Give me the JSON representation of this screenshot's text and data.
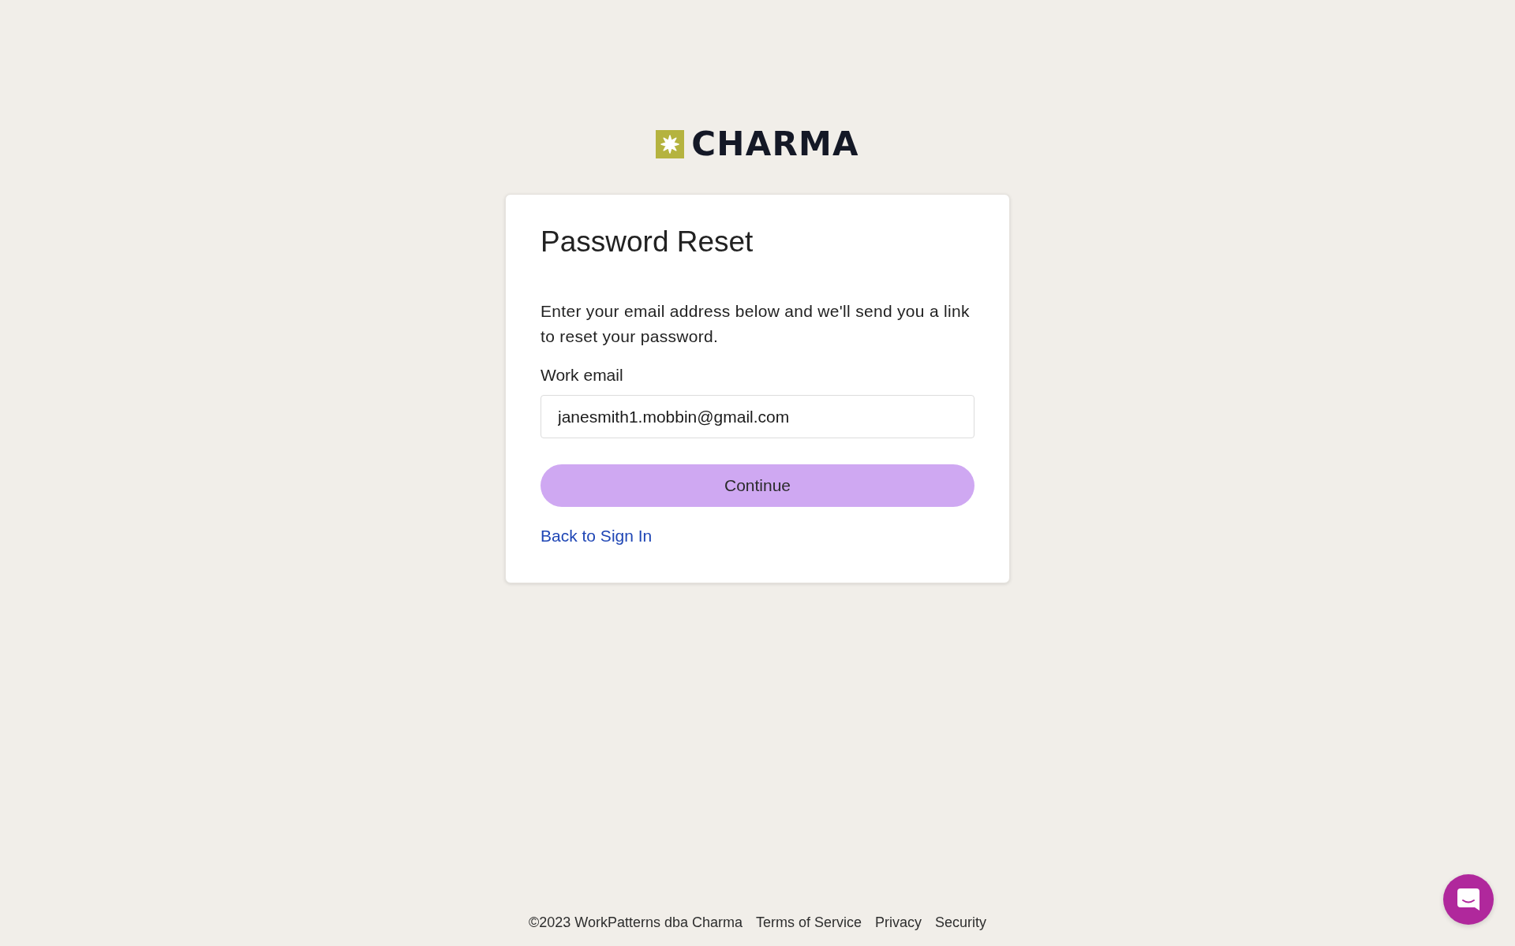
{
  "logo": {
    "text": "CHARMA"
  },
  "card": {
    "title": "Password Reset",
    "description": "Enter your email address below and we'll send you a link to reset your password.",
    "field": {
      "label": "Work email",
      "value": "janesmith1.mobbin@gmail.com"
    },
    "button": "Continue",
    "link": "Back to Sign In"
  },
  "footer": {
    "copyright": "©2023 WorkPatterns dba Charma",
    "links": [
      "Terms of Service",
      "Privacy",
      "Security"
    ]
  }
}
